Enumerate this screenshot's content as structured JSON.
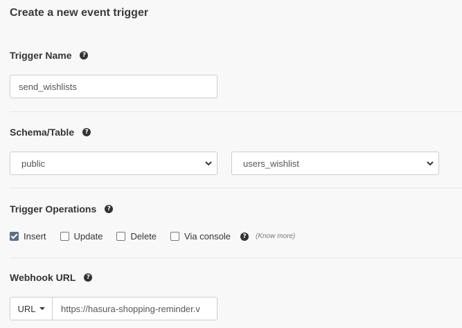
{
  "title": "Create a new event trigger",
  "trigger_name": {
    "label": "Trigger Name",
    "value": "send_wishlists"
  },
  "schema_table": {
    "label": "Schema/Table",
    "schema_value": "public",
    "table_value": "users_wishlist"
  },
  "trigger_operations": {
    "label": "Trigger Operations",
    "ops": [
      {
        "label": "Insert",
        "checked": true
      },
      {
        "label": "Update",
        "checked": false
      },
      {
        "label": "Delete",
        "checked": false
      },
      {
        "label": "Via console",
        "checked": false
      }
    ],
    "know_more": "(Know more)"
  },
  "webhook": {
    "label": "Webhook URL",
    "type_label": "URL",
    "value": "https://hasura-shopping-reminder.v"
  },
  "help_glyph": "?",
  "icons": {
    "help": "question-circle-icon",
    "chevron": "chevron-down-icon"
  }
}
